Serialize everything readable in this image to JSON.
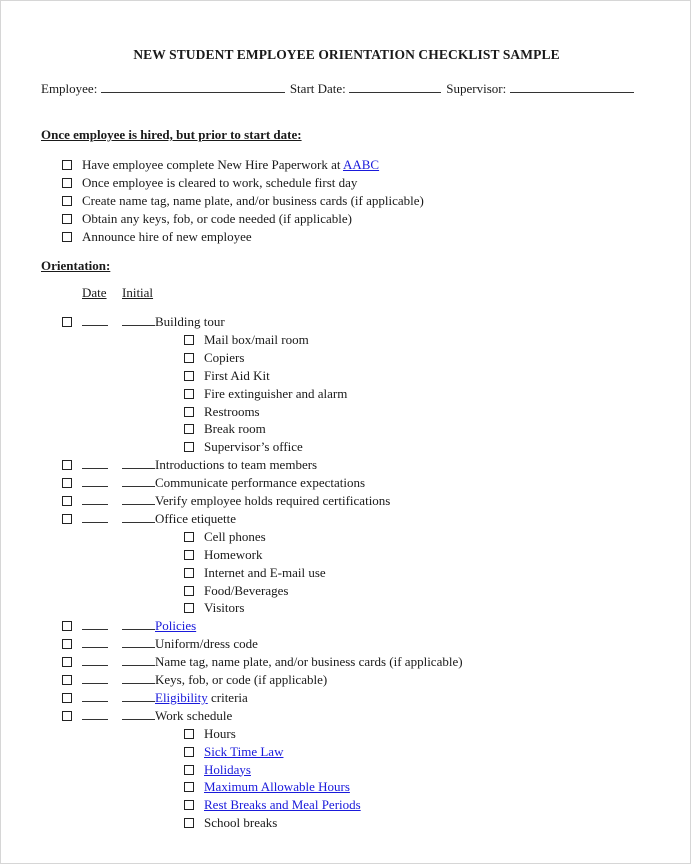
{
  "document": {
    "title": "NEW STUDENT EMPLOYEE ORIENTATION CHECKLIST SAMPLE",
    "fields": {
      "employee_label": "Employee:",
      "start_date_label": "Start Date:",
      "supervisor_label": "Supervisor:"
    },
    "pre_start": {
      "heading": "Once employee is hired, but prior to start date:",
      "items": [
        {
          "text": "Have employee complete New Hire Paperwork at ",
          "link": "AABC"
        },
        {
          "text": "Once employee is cleared to work, schedule first day"
        },
        {
          "text": "Create name tag, name plate, and/or business cards (if applicable)"
        },
        {
          "text": "Obtain any keys, fob, or code needed (if applicable)"
        },
        {
          "text": "Announce hire of new employee"
        }
      ]
    },
    "orientation": {
      "heading": "Orientation:",
      "col_date": "Date",
      "col_initial": "Initial",
      "items": [
        {
          "text": "Building tour",
          "subitems": [
            {
              "text": "Mail box/mail room"
            },
            {
              "text": "Copiers"
            },
            {
              "text": "First Aid Kit"
            },
            {
              "text": "Fire extinguisher and alarm"
            },
            {
              "text": "Restrooms"
            },
            {
              "text": "Break room"
            },
            {
              "text": "Supervisor’s office"
            }
          ]
        },
        {
          "text": "Introductions to team members"
        },
        {
          "text": "Communicate performance expectations"
        },
        {
          "text": "Verify employee holds required certifications"
        },
        {
          "text": "Office etiquette",
          "subitems": [
            {
              "text": "Cell phones"
            },
            {
              "text": "Homework"
            },
            {
              "text": "Internet and E-mail use"
            },
            {
              "text": "Food/Beverages"
            },
            {
              "text": "Visitors"
            }
          ]
        },
        {
          "link": "Policies"
        },
        {
          "text": "Uniform/dress code"
        },
        {
          "text": "Name tag, name plate, and/or business cards (if applicable)"
        },
        {
          "text": "Keys, fob, or code (if applicable)"
        },
        {
          "link": "Eligibility",
          "text": " criteria"
        },
        {
          "text": "Work schedule",
          "subitems": [
            {
              "text": "Hours"
            },
            {
              "link": "Sick Time Law"
            },
            {
              "link": "Holidays"
            },
            {
              "link": "Maximum Allowable Hours"
            },
            {
              "link": "Rest Breaks and Meal Periods"
            },
            {
              "text": "School breaks"
            }
          ]
        }
      ]
    },
    "colors": {
      "link": "#1a1adb",
      "text": "#1a1a1a",
      "border": "#d6d6d6"
    }
  }
}
